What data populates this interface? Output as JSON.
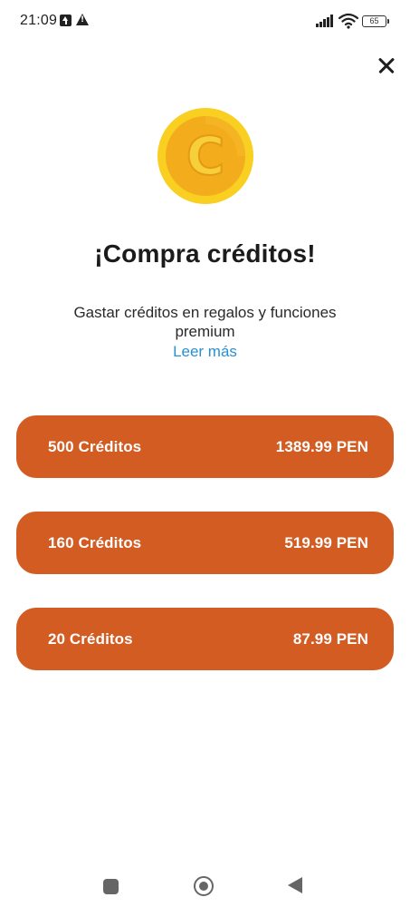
{
  "status_bar": {
    "time": "21:09",
    "battery": "65",
    "icons": [
      "upload-icon",
      "warning-icon",
      "signal-icon",
      "wifi-icon",
      "battery-icon"
    ]
  },
  "header": {
    "close_icon": "close-icon"
  },
  "hero": {
    "coin_icon": "coin-icon",
    "coin_letter": "C",
    "title": "¡Compra créditos!",
    "subtitle": "Gastar créditos en regalos y funciones premium",
    "read_more": "Leer más"
  },
  "packages": [
    {
      "label": "500 Créditos",
      "price": "1389.99 PEN"
    },
    {
      "label": "160 Créditos",
      "price": "519.99 PEN"
    },
    {
      "label": "20 Créditos",
      "price": "87.99 PEN"
    }
  ],
  "nav_bar": {
    "icons": [
      "recents-icon",
      "home-icon",
      "back-icon"
    ]
  },
  "colors": {
    "accent": "#d35c23",
    "link": "#2b8fcf",
    "coin_outer": "#f7c51e",
    "coin_inner": "#f0a81c"
  }
}
